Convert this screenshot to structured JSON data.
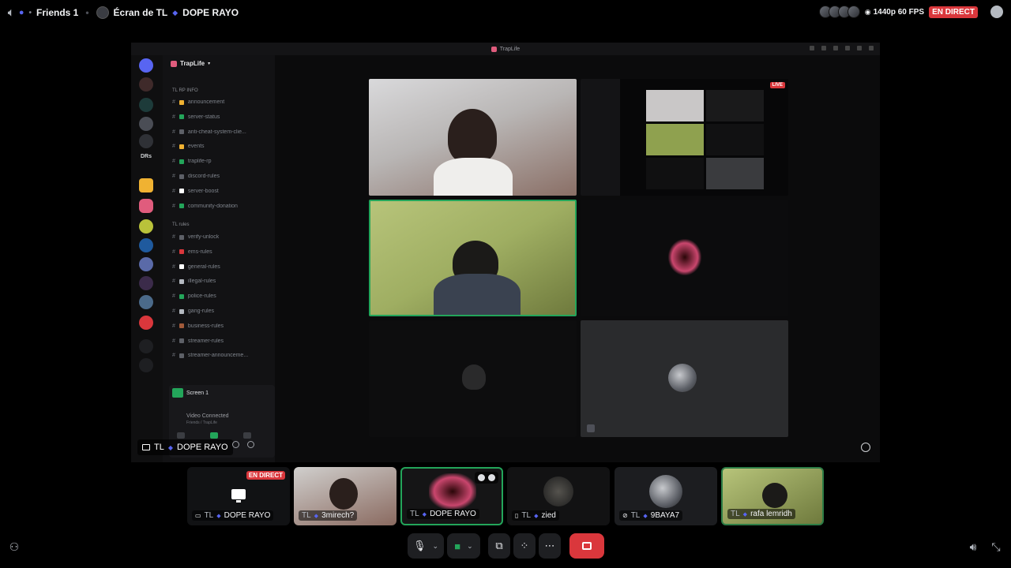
{
  "topbar": {
    "channel_name": "Friends 1",
    "stream_label": "Écran de TL",
    "streamer_name": "DOPE RAYO",
    "quality": "1440p 60 FPS",
    "live_label": "EN DIRECT"
  },
  "shared_screen": {
    "window_title": "TrapLife",
    "server_name": "TrapLife",
    "rail_dms_label": "DRs",
    "categories": [
      "TL RP INFO",
      "TL rules"
    ],
    "channels_info": [
      {
        "name": "announcement",
        "color": "#f0b232"
      },
      {
        "name": "server-status",
        "color": "#23a55a"
      },
      {
        "name": "anti-cheat-system-clie...",
        "color": "#5d6067"
      },
      {
        "name": "events",
        "color": "#f0b232"
      },
      {
        "name": "traplife-rp",
        "color": "#23a55a"
      },
      {
        "name": "discord-rules",
        "color": "#5d6067"
      },
      {
        "name": "server-boost",
        "color": "#ffffff"
      },
      {
        "name": "community-donation",
        "color": "#23a55a"
      }
    ],
    "channels_rules": [
      {
        "name": "verify-unlock",
        "color": "#5d6067"
      },
      {
        "name": "ems-rules",
        "color": "#da373c"
      },
      {
        "name": "general-rules",
        "color": "#ffffff"
      },
      {
        "name": "illegal-rules",
        "color": "#b5bac1"
      },
      {
        "name": "police-rules",
        "color": "#23a55a"
      },
      {
        "name": "gang-rules",
        "color": "#b5bac1"
      },
      {
        "name": "business-rules",
        "color": "#a15a3a"
      },
      {
        "name": "streamer-rules",
        "color": "#5d6067"
      },
      {
        "name": "streamer-announceme...",
        "color": "#5d6067"
      }
    ],
    "voice_screen_label": "Screen 1",
    "voice_connected": "Video Connected",
    "voice_location": "Friends / TrapLife",
    "panel_user_tag": "TL",
    "panel_user_name": "DOPE RAYO",
    "mini_live": "LIVE"
  },
  "participants": [
    {
      "tag": "TL",
      "name": "DOPE RAYO",
      "live": "EN DIRECT",
      "icon": "screen-share-icon"
    },
    {
      "tag": "TL",
      "name": "3mirech?",
      "icon": ""
    },
    {
      "tag": "TL",
      "name": "DOPE RAYO",
      "icon": ""
    },
    {
      "tag": "TL",
      "name": "zied",
      "icon": "phone-icon"
    },
    {
      "tag": "TL",
      "name": "9BAYA7",
      "icon": "mic-off-icon"
    },
    {
      "tag": "TL",
      "name": "rafa lemridh",
      "icon": ""
    }
  ],
  "colors": {
    "accent": "#5865f2",
    "live": "#da373c",
    "speaking": "#23a55a",
    "bg": "#000000"
  }
}
